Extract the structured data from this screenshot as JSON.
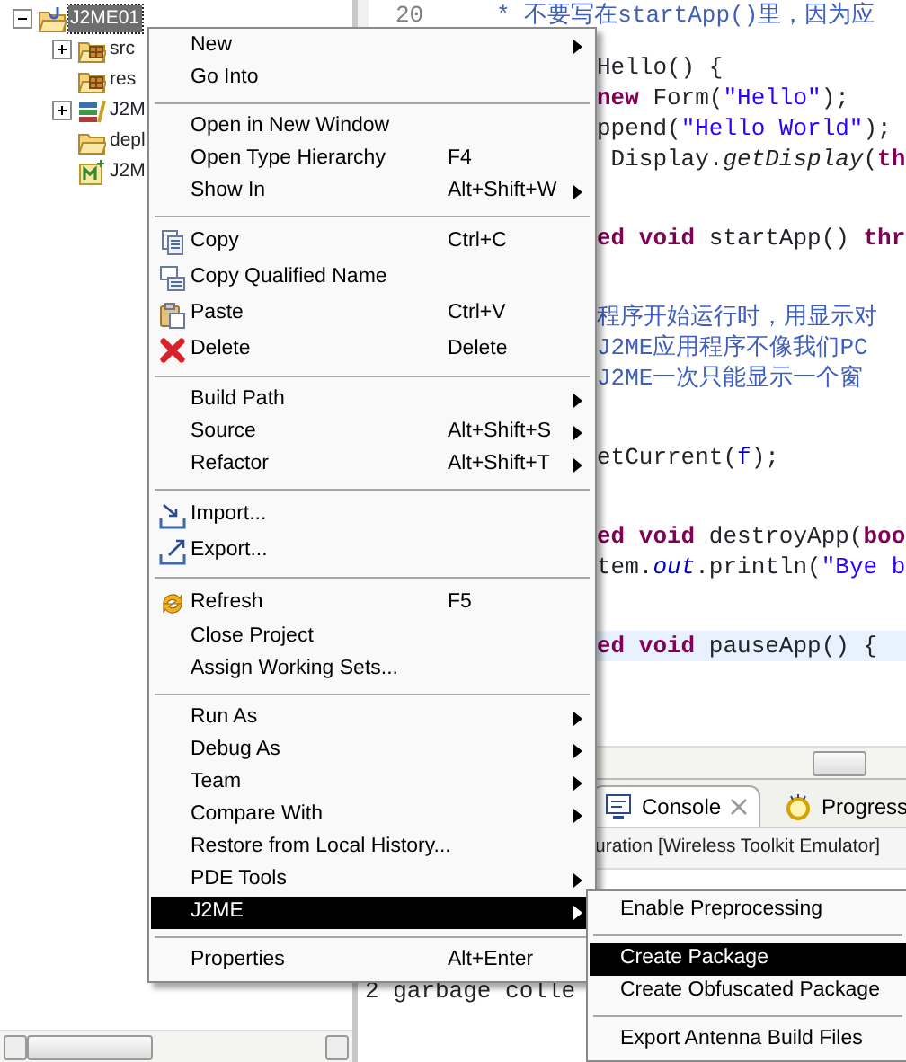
{
  "explorer": {
    "items": [
      {
        "label": "J2ME01",
        "kind": "project",
        "selected": true,
        "expanded": true,
        "children": [
          {
            "label": "src",
            "kind": "source-folder",
            "selected": false,
            "expanded": false
          },
          {
            "label": "res",
            "kind": "source-folder",
            "selected": false
          },
          {
            "label": "J2M",
            "kind": "library",
            "selected": false,
            "expanded": false
          },
          {
            "label": "depl",
            "kind": "folder",
            "selected": false
          },
          {
            "label": "J2M",
            "kind": "manifest",
            "selected": false
          }
        ]
      }
    ]
  },
  "editor": {
    "top_line": {
      "number": "20",
      "segments": [
        {
          "text": "* 不要写在startApp()里，因为应",
          "kind": "comment"
        }
      ]
    },
    "blocks": [
      [
        {
          "highlighted": false,
          "segments": [
            {
              "text": "Hello() {",
              "kind": "plain"
            }
          ]
        },
        {
          "highlighted": false,
          "segments": [
            {
              "text": "new",
              "kind": "keyword"
            },
            {
              "text": " Form(",
              "kind": "plain"
            },
            {
              "text": "\"Hello\"",
              "kind": "string"
            },
            {
              "text": ");",
              "kind": "plain"
            }
          ]
        },
        {
          "highlighted": false,
          "segments": [
            {
              "text": "ppend(",
              "kind": "plain"
            },
            {
              "text": "\"Hello World\"",
              "kind": "string"
            },
            {
              "text": ");",
              "kind": "plain"
            }
          ]
        },
        {
          "highlighted": false,
          "segments": [
            {
              "text": " Display.",
              "kind": "plain"
            },
            {
              "text": "getDisplay",
              "kind": "static-method"
            },
            {
              "text": "(",
              "kind": "plain"
            },
            {
              "text": "th",
              "kind": "keyword"
            }
          ]
        }
      ],
      [
        {
          "highlighted": false,
          "segments": [
            {
              "text": "ed void",
              "kind": "keyword"
            },
            {
              "text": " startApp() ",
              "kind": "plain"
            },
            {
              "text": "thr",
              "kind": "keyword"
            }
          ]
        }
      ],
      [
        {
          "highlighted": false,
          "segments": [
            {
              "text": "程序开始运行时，用显示对",
              "kind": "comment"
            }
          ]
        },
        {
          "highlighted": false,
          "segments": [
            {
              "text": "J2ME应用程序不像我们PC",
              "kind": "comment"
            }
          ]
        },
        {
          "highlighted": false,
          "segments": [
            {
              "text": "J2ME一次只能显示一个窗",
              "kind": "comment"
            }
          ]
        }
      ],
      [
        {
          "highlighted": false,
          "segments": [
            {
              "text": "etCurrent(",
              "kind": "plain"
            },
            {
              "text": "f",
              "kind": "field"
            },
            {
              "text": ");",
              "kind": "plain"
            }
          ]
        }
      ],
      [
        {
          "highlighted": false,
          "segments": [
            {
              "text": "ed void",
              "kind": "keyword"
            },
            {
              "text": " destroyApp(",
              "kind": "plain"
            },
            {
              "text": "boo",
              "kind": "keyword"
            }
          ]
        },
        {
          "highlighted": false,
          "segments": [
            {
              "text": "tem.",
              "kind": "plain"
            },
            {
              "text": "out",
              "kind": "static-field"
            },
            {
              "text": ".println(",
              "kind": "plain"
            },
            {
              "text": "\"Bye b",
              "kind": "string"
            }
          ]
        }
      ],
      [
        {
          "highlighted": true,
          "segments": [
            {
              "text": "ed void",
              "kind": "keyword"
            },
            {
              "text": " pauseApp() {",
              "kind": "plain"
            }
          ]
        }
      ]
    ]
  },
  "console": {
    "tabs": [
      {
        "label": "Console",
        "kind": "console",
        "selected": true,
        "closable": true
      },
      {
        "label": "Progress",
        "kind": "progress",
        "selected": false,
        "closable": false
      }
    ],
    "description": "uration [Wireless Toolkit Emulator]",
    "output": [
      "2 garbage colle"
    ]
  },
  "context_menu": {
    "items": [
      {
        "kind": "plain",
        "label": "New",
        "submenu": true,
        "highlighted": false
      },
      {
        "kind": "plain",
        "label": "Go Into",
        "submenu": false,
        "highlighted": false
      },
      {
        "kind": "separator"
      },
      {
        "kind": "plain",
        "label": "Open in New Window",
        "submenu": false,
        "highlighted": false
      },
      {
        "kind": "plain",
        "label": "Open Type Hierarchy",
        "shortcut": "F4",
        "submenu": false,
        "highlighted": false
      },
      {
        "kind": "plain",
        "label": "Show In",
        "shortcut": "Alt+Shift+W",
        "submenu": true,
        "highlighted": false
      },
      {
        "kind": "separator"
      },
      {
        "kind": "copy",
        "label": "Copy",
        "shortcut": "Ctrl+C",
        "submenu": false,
        "highlighted": false
      },
      {
        "kind": "copy-qualified",
        "label": "Copy Qualified Name",
        "submenu": false,
        "highlighted": false
      },
      {
        "kind": "paste",
        "label": "Paste",
        "shortcut": "Ctrl+V",
        "submenu": false,
        "highlighted": false
      },
      {
        "kind": "delete",
        "label": "Delete",
        "shortcut": "Delete",
        "submenu": false,
        "highlighted": false
      },
      {
        "kind": "separator"
      },
      {
        "kind": "plain",
        "label": "Build Path",
        "submenu": true,
        "highlighted": false
      },
      {
        "kind": "plain",
        "label": "Source",
        "shortcut": "Alt+Shift+S",
        "submenu": true,
        "highlighted": false
      },
      {
        "kind": "plain",
        "label": "Refactor",
        "shortcut": "Alt+Shift+T",
        "submenu": true,
        "highlighted": false
      },
      {
        "kind": "separator"
      },
      {
        "kind": "import",
        "label": "Import...",
        "submenu": false,
        "highlighted": false
      },
      {
        "kind": "export",
        "label": "Export...",
        "submenu": false,
        "highlighted": false
      },
      {
        "kind": "separator"
      },
      {
        "kind": "refresh",
        "label": "Refresh",
        "shortcut": "F5",
        "submenu": false,
        "highlighted": false
      },
      {
        "kind": "plain",
        "label": "Close Project",
        "submenu": false,
        "highlighted": false
      },
      {
        "kind": "plain",
        "label": "Assign Working Sets...",
        "submenu": false,
        "highlighted": false
      },
      {
        "kind": "separator"
      },
      {
        "kind": "plain",
        "label": "Run As",
        "submenu": true,
        "highlighted": false
      },
      {
        "kind": "plain",
        "label": "Debug As",
        "submenu": true,
        "highlighted": false
      },
      {
        "kind": "plain",
        "label": "Team",
        "submenu": true,
        "highlighted": false
      },
      {
        "kind": "plain",
        "label": "Compare With",
        "submenu": true,
        "highlighted": false
      },
      {
        "kind": "plain",
        "label": "Restore from Local History...",
        "submenu": false,
        "highlighted": false
      },
      {
        "kind": "plain",
        "label": "PDE Tools",
        "submenu": true,
        "highlighted": false
      },
      {
        "kind": "plain",
        "label": "J2ME",
        "submenu": true,
        "highlighted": true
      },
      {
        "kind": "separator"
      },
      {
        "kind": "plain",
        "label": "Properties",
        "shortcut": "Alt+Enter",
        "submenu": false,
        "highlighted": false
      }
    ]
  },
  "submenu": {
    "items": [
      {
        "kind": "plain",
        "label": "Enable Preprocessing",
        "highlighted": false
      },
      {
        "kind": "separator"
      },
      {
        "kind": "plain",
        "label": "Create Package",
        "highlighted": true
      },
      {
        "kind": "plain",
        "label": "Create Obfuscated Package",
        "highlighted": false
      },
      {
        "kind": "separator"
      },
      {
        "kind": "plain",
        "label": "Export Antenna Build Files",
        "highlighted": false
      }
    ]
  }
}
